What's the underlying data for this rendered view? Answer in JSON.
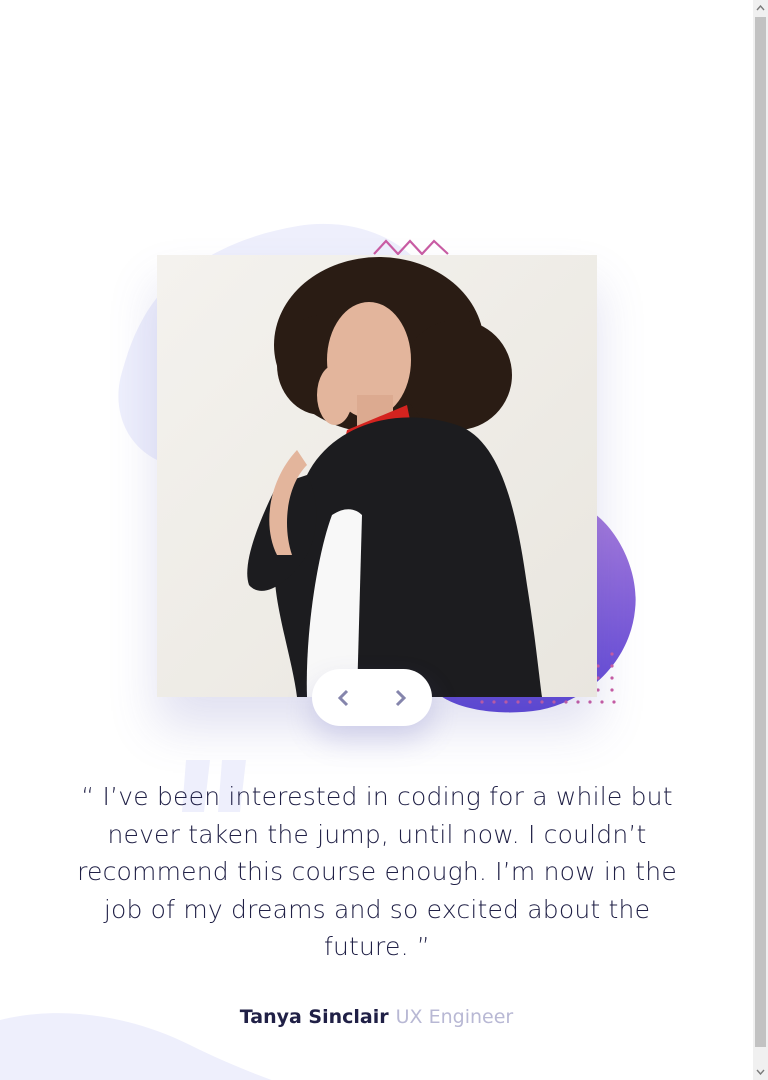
{
  "testimonial": {
    "quote": "“ I’ve been interested in coding for a while but never taken the jump, until now. I couldn’t recommend this course enough. I’m now in the job of my dreams and so excited about the future. ”",
    "author_name": "Tanya Sinclair",
    "author_role": "UX Engineer",
    "photo_alt": "Portrait of Tanya Sinclair"
  },
  "navigation": {
    "previous_icon": "chevron-left-icon",
    "next_icon": "chevron-right-icon"
  },
  "colors": {
    "background": "#ffffff",
    "text_dark": "#202046",
    "text_muted": "#b8b8d4",
    "blob_light": "#eeeffc",
    "blob_purple": "#6d4fd8",
    "accent_pink": "#c95ca3",
    "nav_icon": "#8585ac"
  }
}
